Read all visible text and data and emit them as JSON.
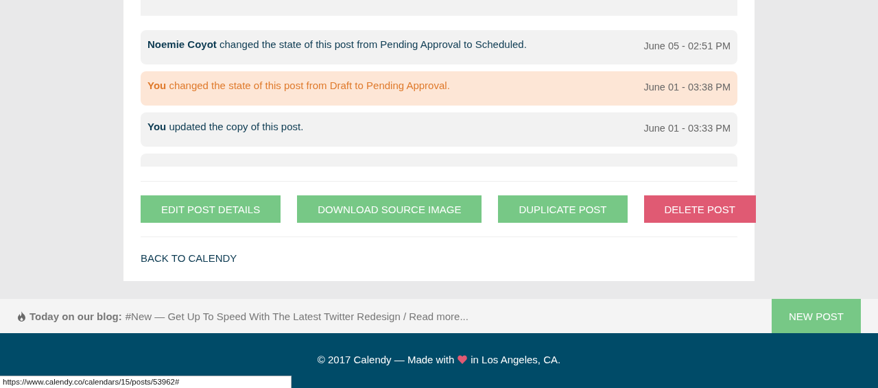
{
  "activity": [
    {
      "actor": "Noemie Coyot",
      "text": "changed the state of this post from Pending Approval to Scheduled.",
      "time": "June 05 - 02:51 PM",
      "highlighted": false
    },
    {
      "actor": "You",
      "text": "changed the state of this post from Draft to Pending Approval.",
      "time": "June 01 - 03:38 PM",
      "highlighted": true
    },
    {
      "actor": "You",
      "text": "updated the copy of this post.",
      "time": "June 01 - 03:33 PM",
      "highlighted": false
    }
  ],
  "actions": [
    {
      "label": "EDIT POST DETAILS",
      "kind": "primary"
    },
    {
      "label": "DOWNLOAD SOURCE IMAGE",
      "kind": "primary"
    },
    {
      "label": "DUPLICATE POST",
      "kind": "primary"
    },
    {
      "label": "DELETE POST",
      "kind": "danger"
    }
  ],
  "back_link": "BACK TO CALENDY",
  "blog_bar": {
    "label": "Today on our blog:",
    "text": "#New — Get Up To Speed With The Latest Twitter Redesign / Read more...",
    "button": "NEW POST"
  },
  "footer": {
    "before": "© 2017 Calendy — Made with",
    "after": "in Los Angeles, CA."
  },
  "status_bar": "https://www.calendy.co/calendars/15/posts/53962#"
}
